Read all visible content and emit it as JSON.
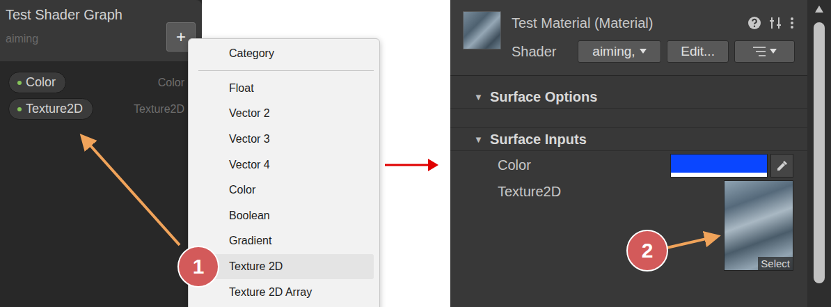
{
  "blackboard": {
    "title": "Test Shader Graph",
    "subtitle": "aiming",
    "add_button": "+",
    "properties": [
      {
        "name": "Color",
        "type": "Color"
      },
      {
        "name": "Texture2D",
        "type": "Texture2D"
      }
    ]
  },
  "add_menu": {
    "groups": [
      {
        "items": [
          {
            "label": "Category",
            "selected": false
          }
        ]
      },
      {
        "items": [
          {
            "label": "Float",
            "selected": false
          },
          {
            "label": "Vector 2",
            "selected": false
          },
          {
            "label": "Vector 3",
            "selected": false
          },
          {
            "label": "Vector 4",
            "selected": false
          },
          {
            "label": "Color",
            "selected": false
          },
          {
            "label": "Boolean",
            "selected": false
          },
          {
            "label": "Gradient",
            "selected": false
          },
          {
            "label": "Texture 2D",
            "selected": true
          },
          {
            "label": "Texture 2D Array",
            "selected": false
          }
        ]
      }
    ]
  },
  "inspector": {
    "title": "Test Material (Material)",
    "shader_label": "Shader",
    "shader_value": "aiming,",
    "edit_button": "Edit...",
    "sections": [
      {
        "label": "Surface Options",
        "arrow": "▼",
        "expanded": true
      },
      {
        "label": "Surface Inputs",
        "arrow": "▼",
        "expanded": true
      }
    ],
    "inputs": [
      {
        "kind": "color",
        "label": "Color",
        "value": "#0a46ff"
      },
      {
        "kind": "texture",
        "label": "Texture2D",
        "button": "Select"
      }
    ]
  },
  "annotations": [
    {
      "number": "1"
    },
    {
      "number": "2"
    }
  ]
}
